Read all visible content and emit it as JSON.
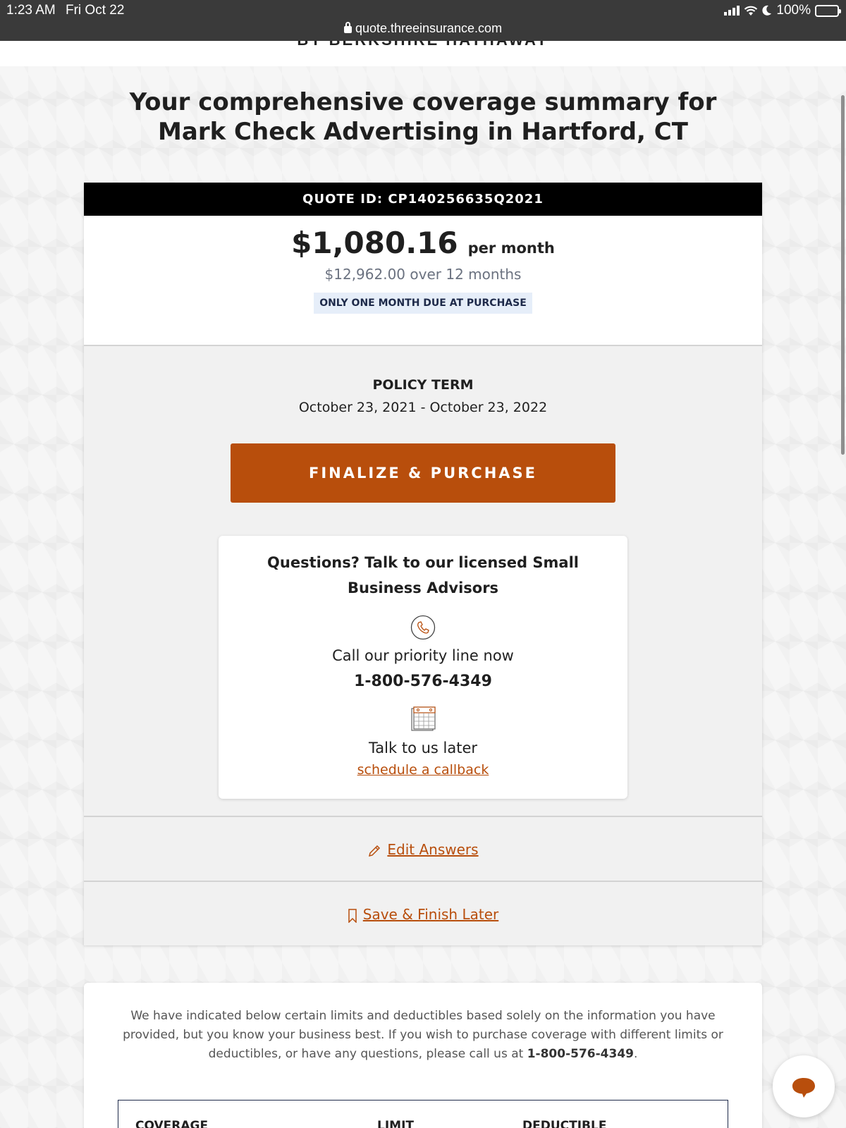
{
  "status_bar": {
    "time": "1:23 AM",
    "date": "Fri Oct 22",
    "battery": "100%"
  },
  "browser": {
    "url": "quote.threeinsurance.com"
  },
  "brand": {
    "tagline_cut": "BY BERKSHIRE HATHAWAY"
  },
  "page_title": "Your comprehensive coverage summary for Mark Check Advertising in Hartford, CT",
  "quote": {
    "id_label": "QUOTE ID: CP140256635Q2021",
    "price": "$1,080.16",
    "price_unit": "per month",
    "total": "$12,962.00 over 12 months",
    "due_badge": "ONLY ONE MONTH DUE AT PURCHASE"
  },
  "policy": {
    "term_label": "POLICY TERM",
    "term_dates": "October 23, 2021 - October 23, 2022"
  },
  "purchase_button": "FINALIZE & PURCHASE",
  "advisor": {
    "title": "Questions? Talk to our licensed Small Business Advisors",
    "call_text": "Call our priority line now",
    "phone": "1-800-576-4349",
    "later_text": "Talk to us later",
    "callback_link": "schedule a callback"
  },
  "actions": {
    "edit": "Edit Answers",
    "save": "Save & Finish Later"
  },
  "info": {
    "text_before": "We have indicated below certain limits and deductibles based solely on the information you have provided, but you know your business best. If you wish to purchase coverage with different limits or deductibles, or have any questions, please call us at ",
    "phone": "1-800-576-4349",
    "text_after": "."
  },
  "coverage_table": {
    "headers": [
      "COVERAGE",
      "LIMIT",
      "DEDUCTIBLE"
    ]
  },
  "colors": {
    "accent": "#b84e0c",
    "badge_bg": "#e6eef9",
    "quote_bar": "#000000"
  }
}
